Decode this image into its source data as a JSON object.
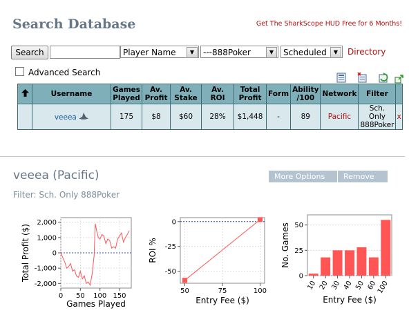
{
  "header": {
    "title": "Search Database",
    "promo": "Get The SharkScope HUD Free for 6 Months!"
  },
  "search": {
    "button_label": "Search",
    "input_value": "",
    "field_select": "Player Name",
    "network_select": "---888Poker",
    "type_select": "Scheduled",
    "directory_link": "Directory",
    "advanced_label": "Advanced Search"
  },
  "icons": [
    "export-icon",
    "delete-icon",
    "refresh-icon",
    "popout-icon"
  ],
  "table": {
    "headers": [
      "Username",
      "Games Played",
      "Av. Profit",
      "Av. Stake",
      "Av. ROI",
      "Total Profit",
      "Form",
      "Ability /100",
      "Network",
      "Filter"
    ],
    "row": {
      "username": "veeea",
      "games_played": "175",
      "av_profit": "$8",
      "av_stake": "$60",
      "av_roi": "28%",
      "total_profit": "$1,448",
      "form": "-",
      "ability": "89",
      "network": "Pacific",
      "filter_line1": "Sch. Only",
      "filter_line2": "888Poker",
      "remove": "x"
    }
  },
  "player": {
    "heading": "veeea (Pacific)",
    "more_options": "More Options",
    "remove": "Remove",
    "filter": "Filter: Sch. Only 888Poker"
  },
  "colors": {
    "title": "#667788",
    "accent_red": "#b01010",
    "header_cell": "#7fb0ba",
    "row_cell": "#d9e8ec",
    "series": "#ff5555"
  },
  "chart_data": [
    {
      "type": "line",
      "xlabel": "Games Played",
      "ylabel": "Total Profit ($)",
      "xlim": [
        0,
        180
      ],
      "ylim": [
        -2300,
        2300
      ],
      "xticks": [
        0,
        50,
        100,
        150
      ],
      "yticks": [
        -2000,
        -1000,
        0,
        1000,
        2000
      ],
      "ytick_labels": [
        "-2,000",
        "-1,000",
        "0",
        "1,000",
        "2,000"
      ],
      "x": [
        0,
        5,
        10,
        15,
        20,
        25,
        30,
        35,
        40,
        45,
        50,
        55,
        60,
        65,
        70,
        75,
        80,
        85,
        88,
        92,
        96,
        100,
        105,
        110,
        115,
        120,
        125,
        130,
        135,
        140,
        145,
        150,
        155,
        160,
        165,
        170,
        175
      ],
      "y": [
        0,
        -300,
        -600,
        -1000,
        -900,
        -700,
        -1200,
        -1100,
        -1500,
        -1600,
        -1200,
        -1700,
        -1500,
        -2000,
        -1900,
        -2100,
        -1400,
        -200,
        1900,
        1400,
        1000,
        900,
        1200,
        1100,
        600,
        900,
        800,
        300,
        400,
        300,
        900,
        1100,
        1300,
        700,
        1000,
        1200,
        1450
      ]
    },
    {
      "type": "line",
      "xlabel": "Entry Fee ($)",
      "ylabel": "ROI %",
      "xlim": [
        47,
        103
      ],
      "ylim": [
        -62,
        4
      ],
      "xticks": [
        50,
        75,
        100
      ],
      "yticks": [
        -50,
        -25,
        0
      ],
      "ytick_labels": [
        "-50",
        "-25",
        "0"
      ],
      "x": [
        50,
        100
      ],
      "y": [
        -59,
        2
      ]
    },
    {
      "type": "bar",
      "xlabel": "Entry Fee ($)",
      "ylabel": "No. Games",
      "categories": [
        "10",
        "20",
        "30",
        "40",
        "50",
        "60",
        "100"
      ],
      "values": [
        2,
        18,
        25,
        25,
        28,
        18,
        55
      ],
      "ylim": [
        0,
        60
      ],
      "yticks": [
        0,
        25,
        50
      ]
    }
  ]
}
